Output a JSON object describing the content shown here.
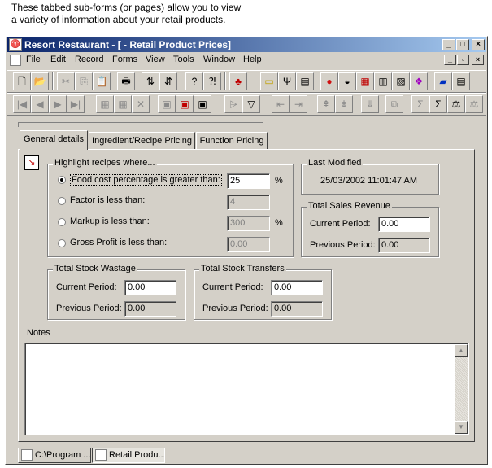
{
  "annotation": {
    "line1": "These tabbed sub-forms (or pages) allow you to view",
    "line2": "a variety of information about your retail products."
  },
  "window": {
    "title": "Resort Restaurant - [ - Retail Product Prices]",
    "caption_buttons": [
      "_",
      "□",
      "×"
    ],
    "mdi_buttons": [
      "_",
      "▫",
      "×"
    ]
  },
  "menu": [
    "File",
    "Edit",
    "Record",
    "Forms",
    "View",
    "Tools",
    "Window",
    "Help"
  ],
  "tabs": [
    {
      "label": "General details",
      "active": true
    },
    {
      "label": "Ingredient/Recipe Pricing",
      "active": false
    },
    {
      "label": "Function Pricing",
      "active": false
    }
  ],
  "highlight": {
    "title": "Highlight recipes where...",
    "options": [
      {
        "label": "Food cost percentage is greater than:",
        "value": "25",
        "unit": "%",
        "selected": true
      },
      {
        "label": "Factor is less than:",
        "value": "4",
        "unit": "",
        "selected": false
      },
      {
        "label": "Markup is less than:",
        "value": "300",
        "unit": "%",
        "selected": false
      },
      {
        "label": "Gross Profit is less than:",
        "value": "0.00",
        "unit": "",
        "selected": false
      }
    ]
  },
  "last_modified": {
    "title": "Last Modified",
    "value": "25/03/2002 11:01:47 AM"
  },
  "sales_revenue": {
    "title": "Total Sales Revenue",
    "current_label": "Current Period:",
    "current_value": "0.00",
    "previous_label": "Previous Period:",
    "previous_value": "0.00"
  },
  "stock_wastage": {
    "title": "Total Stock Wastage",
    "current_label": "Current Period:",
    "current_value": "0.00",
    "previous_label": "Previous Period:",
    "previous_value": "0.00"
  },
  "stock_transfers": {
    "title": "Total Stock Transfers",
    "current_label": "Current Period:",
    "current_value": "0.00",
    "previous_label": "Previous Period:",
    "previous_value": "0.00"
  },
  "notes": {
    "label": "Notes",
    "value": ""
  },
  "taskbar": [
    {
      "label": "C:\\Program ...",
      "active": false
    },
    {
      "label": "Retail Produ...",
      "active": true
    }
  ],
  "toolbar1_icons": [
    "new-icon",
    "open-icon",
    "cut-icon",
    "copy-icon",
    "paste-icon",
    "print-icon",
    "sort-asc-icon",
    "sort-desc-icon",
    "help-icon",
    "context-help-icon",
    "ingredients-icon",
    "container-icon",
    "cutlery-icon",
    "menu-icon",
    "tomato-icon",
    "pot-icon",
    "calendar-icon",
    "book-icon",
    "report-icon",
    "palette-icon",
    "truck-icon",
    "document-icon"
  ],
  "toolbar2_icons": [
    "first-record-icon",
    "previous-record-icon",
    "next-record-icon",
    "last-record-icon",
    "new-record-icon",
    "duplicate-record-icon",
    "delete-record-icon",
    "save-icon",
    "save-close-icon",
    "save-new-icon",
    "filter-form-icon",
    "filter-icon",
    "move-left-icon",
    "move-right-icon",
    "move-up-icon",
    "move-down-icon",
    "import-icon",
    "export-icon",
    "sum-icon",
    "sum-all-icon",
    "balance-icon",
    "scale-icon"
  ]
}
